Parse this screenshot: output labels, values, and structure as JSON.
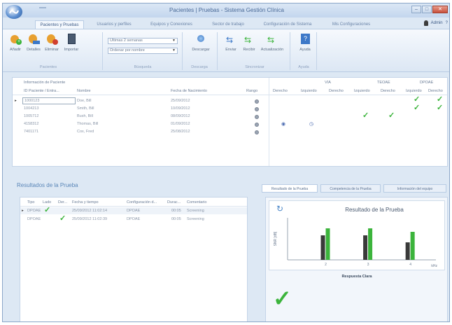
{
  "window": {
    "title": "Pacientes | Pruebas - Sistema Gestión Clínica",
    "min_label": "–",
    "max_label": "□",
    "close_label": "✕"
  },
  "ribbon_tabs": [
    {
      "label": "Pacientes y Pruebas",
      "active": true
    },
    {
      "label": "Usuarios y perfiles",
      "active": false
    },
    {
      "label": "Equipos y Conexiones",
      "active": false
    },
    {
      "label": "Sector de trabajo",
      "active": false
    },
    {
      "label": "Configuración de Sistema",
      "active": false
    },
    {
      "label": "Mis Configuraciones",
      "active": false
    }
  ],
  "user": {
    "name": "Admin",
    "help": "?"
  },
  "ribbon": {
    "buttons": {
      "add": "Añadir",
      "details": "Detalles",
      "delete": "Eliminar",
      "import": "Importar",
      "download": "Descargar",
      "send": "Enviar",
      "receive": "Recibir",
      "update": "Actualización",
      "help": "Ayuda"
    },
    "filter_select": "Últimas 2 semanas",
    "order_select": "Ordenar por nombre",
    "groups": {
      "patients": "Pacientes",
      "search": "Búsqueda",
      "download": "Descarga",
      "sync": "Sincronizar",
      "help": "Ayuda"
    }
  },
  "grid": {
    "group_header": "Información de Paciente",
    "headers": {
      "id": "ID Paciente / Entra...",
      "name": "Nombre",
      "dob": "Fecha de Nacimiento",
      "range": "Rango"
    },
    "test_groups": [
      "VIA",
      "TEOAE",
      "DPOAE"
    ],
    "test_subheaders": [
      "Derecho",
      "Izquierdo",
      "Derecho",
      "Izquierdo",
      "Derecho",
      "Izquierdo",
      "Derecho"
    ],
    "rows": [
      {
        "id": "1000123",
        "name": "Doe, Bill",
        "dob": "25/09/2012"
      },
      {
        "id": "1004213",
        "name": "Smith, Bill",
        "dob": "10/09/2012"
      },
      {
        "id": "1005712",
        "name": "Bush, Bill",
        "dob": "08/09/2012"
      },
      {
        "id": "4158312",
        "name": "Thomas, Bill",
        "dob": "01/09/2012"
      },
      {
        "id": "7401171",
        "name": "Cox, Fred",
        "dob": "25/08/2012"
      }
    ],
    "check": "✓",
    "eye": "◉",
    "clock": "◷"
  },
  "results": {
    "title": "Resultados de la Prueba",
    "headers": [
      "Tipo",
      "Lado",
      "Der...",
      "Fecha y tiempo",
      "Configuración d...",
      "Durac...",
      "Comentario"
    ],
    "rows": [
      {
        "type": "DPOAE",
        "date": "25/09/2012 11:02:14",
        "config": "DPOAE",
        "duration": "00:05",
        "comment": "Screening"
      },
      {
        "type": "DPOAE",
        "date": "25/09/2012 11:02:39",
        "config": "DPOAE",
        "duration": "00:05",
        "comment": "Screening"
      }
    ]
  },
  "tabs": [
    {
      "label": "Resultado de la Prueba",
      "active": true
    },
    {
      "label": "Competencia de la Prueba",
      "active": false
    },
    {
      "label": "Información del equipo",
      "active": false
    }
  ],
  "chart_panel": {
    "title": "Resultado de la Prueba",
    "refresh_icon": "↻",
    "sequence_label": "Respuesta Clara",
    "result_check": "✓"
  },
  "chart_data": {
    "type": "bar",
    "title": "Resultado de la Prueba",
    "xlabel": "kHz",
    "ylabel": "SNR [dB]",
    "categories": [
      "2",
      "3",
      "4"
    ],
    "series": [
      {
        "values": [
          7,
          7,
          5
        ],
        "color": "#3a3a3a"
      },
      {
        "values": [
          9,
          9,
          8
        ],
        "color": "#3cb43c"
      }
    ],
    "ylim": [
      0,
      12
    ]
  },
  "colors": {
    "accent": "#4a86c8",
    "pass": "#3cb43c"
  }
}
